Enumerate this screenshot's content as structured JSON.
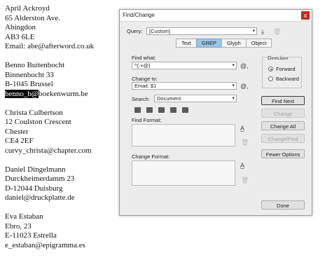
{
  "document": {
    "entries": [
      [
        "April Ackroyd",
        "65 Alderston Ave.",
        "Abingdon",
        "AB3 6LE",
        "Email: abe@afterword.co.uk"
      ],
      [
        "Benno Buitenbocht",
        "Binnenbocht 33",
        "B-1045 Brussel"
      ],
      [
        "Christa Culbertson",
        "12 Coulston Crescent",
        "Chester",
        "CE4 2EF",
        "curvy_christa@chapter.com"
      ],
      [
        "Daniel Dingelmann",
        "Durckheimerdamm 23",
        "D-12044 Duisburg",
        "daniel@druckplatte.de"
      ],
      [
        "Eva Estaban",
        "Ebro, 23",
        "E-11023 Estrella",
        "e_estaban@epigramma.es"
      ]
    ],
    "email_selected": "benno_b@",
    "email_rest": "boekenwurm.be"
  },
  "dialog": {
    "title": "Find/Change",
    "close": "x",
    "query_label": "Query:",
    "query_value": "[Custom]",
    "tabs": [
      "Text",
      "GREP",
      "Glyph",
      "Object"
    ],
    "active_tab": "GREP",
    "find_what_label": "Find what:",
    "find_what_value": "^(.+@)",
    "change_to_label": "Change to:",
    "change_to_value": "Email: $1",
    "search_label": "Search:",
    "search_value": "Document",
    "direction_label": "Direction",
    "forward_label": "Forward",
    "backward_label": "Backward",
    "find_format_label": "Find Format:",
    "change_format_label": "Change Format:",
    "buttons": {
      "find_next": "Find Next",
      "change": "Change",
      "change_all": "Change All",
      "change_find": "Change/Find",
      "fewer_options": "Fewer Options",
      "done": "Done"
    },
    "special_char_glyph": "@,",
    "dropdown_arrow": "▾"
  }
}
